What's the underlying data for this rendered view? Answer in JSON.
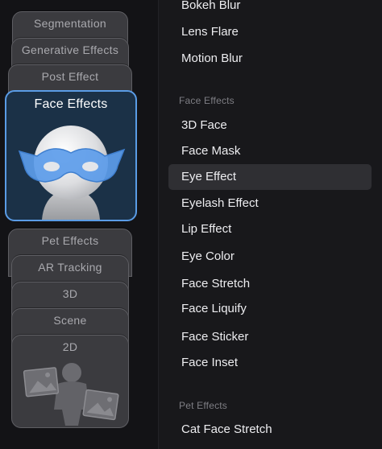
{
  "categories": {
    "segmentation": "Segmentation",
    "generative_effects": "Generative Effects",
    "post_effect": "Post Effect",
    "face_effects": "Face Effects",
    "pet_effects": "Pet Effects",
    "ar_tracking": "AR Tracking",
    "three_d": "3D",
    "scene": "Scene",
    "two_d": "2D",
    "selected": "Face Effects"
  },
  "effects": {
    "top_items": [
      "Bokeh Blur",
      "Lens Flare",
      "Motion Blur"
    ],
    "face_section_label": "Face Effects",
    "face_items": [
      "3D Face",
      "Face Mask",
      "Eye Effect",
      "Eyelash Effect",
      "Lip Effect",
      "Eye Color",
      "Face Stretch",
      "Face Liquify",
      "Face Sticker",
      "Face Inset"
    ],
    "selected_item": "Eye Effect",
    "pet_section_label": "Pet Effects",
    "pet_items": [
      "Cat Face Stretch"
    ]
  },
  "colors": {
    "accent_border": "#5a9ce6",
    "selected_card_bg": "#1b3147",
    "mask_blue": "#5c9cea",
    "card_bg": "#3b3b3f"
  },
  "icons": {
    "face_card": "masked-head-icon",
    "two_d_card": "person-with-images-icon"
  }
}
